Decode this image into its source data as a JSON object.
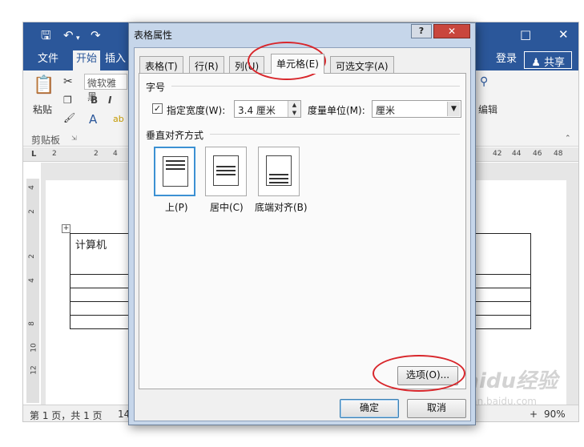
{
  "word": {
    "quick_access": {
      "save_icon": "save-icon",
      "undo_icon": "undo-icon",
      "redo_icon": "redo-icon"
    },
    "menu_tabs": [
      {
        "label": "文件"
      },
      {
        "label": "开始"
      },
      {
        "label": "插入"
      }
    ],
    "login_label": "登录",
    "share_label": "共享",
    "ribbon": {
      "paste_label": "粘贴",
      "clipboard_label": "剪贴板",
      "font_name": "微软雅黑",
      "bold_label": "B",
      "italic_label": "I",
      "edit_label": "编辑"
    },
    "ruler_ticks": [
      "2",
      "2",
      "4",
      "42",
      "44",
      "46",
      "48"
    ],
    "vruler_ticks": [
      "4",
      "2",
      "2",
      "4",
      "8",
      "10",
      "12"
    ],
    "table_first_cell": "计算机",
    "status": {
      "page_info": "第 1 页，共 1 页",
      "partial": "14",
      "zoom": "90%",
      "zoom_plus": "+"
    }
  },
  "dialog": {
    "title": "表格属性",
    "help_label": "?",
    "close_label": "✕",
    "tabs": [
      {
        "label": "表格(T)"
      },
      {
        "label": "行(R)"
      },
      {
        "label": "列(U)"
      },
      {
        "label": "单元格(E)"
      },
      {
        "label": "可选文字(A)"
      }
    ],
    "size_section": "字号",
    "specify_width_checked": "✓",
    "specify_width_label": "指定宽度(W):",
    "width_value": "3.4 厘米",
    "measure_label": "度量单位(M):",
    "measure_value": "厘米",
    "valign_section": "垂直对齐方式",
    "align_options": [
      {
        "label": "上(P)"
      },
      {
        "label": "居中(C)"
      },
      {
        "label": "底端对齐(B)"
      }
    ],
    "options_label": "选项(O)...",
    "ok_label": "确定",
    "cancel_label": "取消"
  },
  "watermark": {
    "brand": "Baidu经验",
    "sub": "jingyan.baidu.com"
  },
  "colors": {
    "word_blue": "#2b579a",
    "annotation_red": "#d8262b",
    "dialog_frame": "#c6d6ea",
    "selected_blue": "#3c91d3"
  }
}
